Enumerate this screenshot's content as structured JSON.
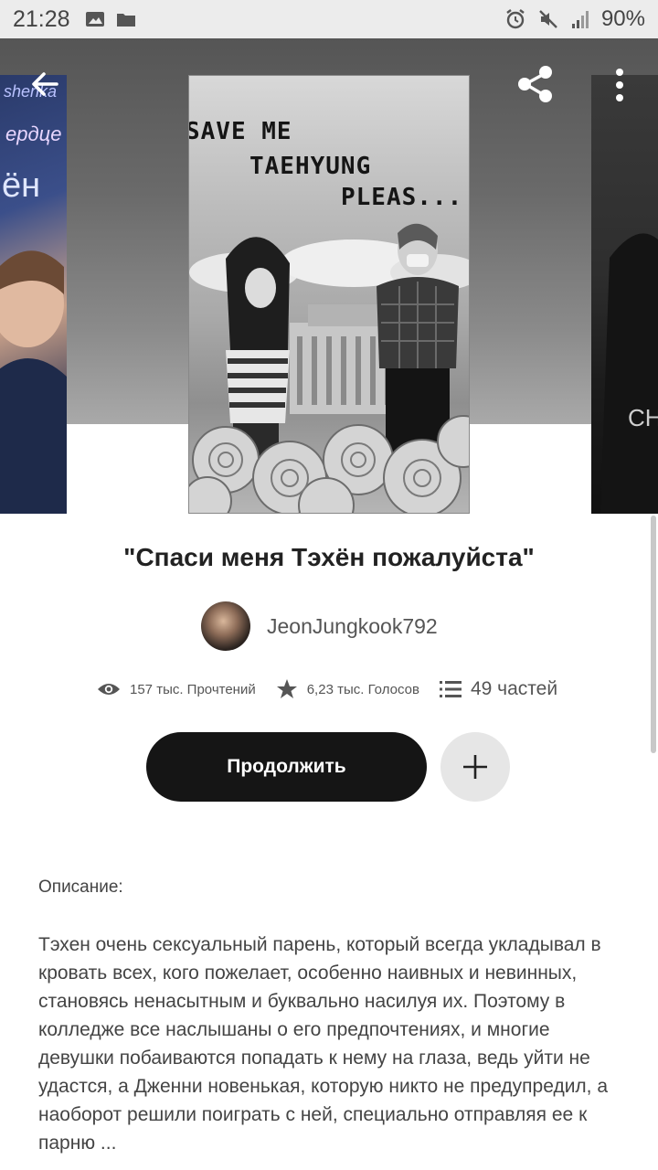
{
  "status_bar": {
    "time": "21:28",
    "battery": "90%",
    "icons": [
      "image-icon",
      "folder-icon",
      "alarm-icon",
      "mute-icon",
      "signal-icon"
    ]
  },
  "nav": {
    "back_icon": "back-arrow-icon",
    "share_icon": "share-icon",
    "more_icon": "more-vertical-icon"
  },
  "cover": {
    "line1": "SAVE ME",
    "line2": "TAEHYUNG",
    "line3": "PLEAS..."
  },
  "side_covers": {
    "left_line1": "shenka",
    "left_line2": "ердце",
    "left_line3": "ён",
    "right_line1": "CH"
  },
  "story": {
    "title": "\"Спаси меня Тэхён пожалуйста\"",
    "author": "JeonJungkook792"
  },
  "stats": {
    "reads": "157 тыс. Прочтений",
    "votes": "6,23 тыс. Голосов",
    "parts": "49 частей"
  },
  "actions": {
    "continue_label": "Продолжить"
  },
  "description": {
    "label": "Описание:",
    "text": "Тэхен очень сексуальный парень, который всегда укладывал в кровать всех, кого пожелает, особенно наивных и невинных, становясь ненасытным и буквально насилуя их. Поэтому в колледже все наслышаны о его предпочтениях, и многие девушки побаиваются попадать к нему на глаза, ведь уйти не удастся, а Дженни новенькая, которую никто не предупредил, а наоборот решили поиграть с ней, специально отправляя ее к парню ..."
  },
  "colors": {
    "button_dark": "#151515",
    "button_light": "#e6e6e6",
    "text_primary": "#222222",
    "text_secondary": "#555555"
  }
}
